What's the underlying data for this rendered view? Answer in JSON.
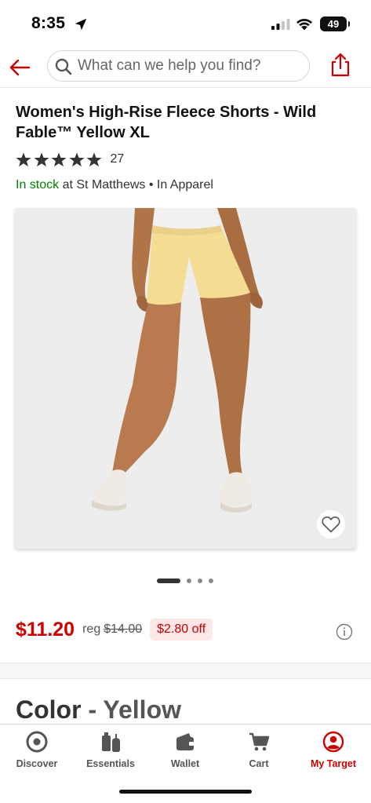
{
  "status_bar": {
    "time": "8:35",
    "battery": "49"
  },
  "search": {
    "placeholder": "What can we help you find?"
  },
  "product": {
    "title": "Women's High-Rise Fleece Shorts - Wild Fable™ Yellow XL",
    "rating": 5,
    "review_count": "27",
    "stock_status": "In stock",
    "stock_location": " at St Matthews • In Apparel",
    "price": "$11.20",
    "reg_label": "reg",
    "reg_price": "$14.00",
    "discount": "$2.80 off",
    "color_label": "Color",
    "color_separator": " - ",
    "color_value": "Yellow",
    "image_count": 4,
    "active_image": 1
  },
  "tabs": [
    {
      "label": "Discover",
      "icon": "target-logo-icon",
      "active": false
    },
    {
      "label": "Essentials",
      "icon": "essentials-icon",
      "active": false
    },
    {
      "label": "Wallet",
      "icon": "wallet-icon",
      "active": false
    },
    {
      "label": "Cart",
      "icon": "cart-icon",
      "active": false
    },
    {
      "label": "My Target",
      "icon": "account-icon",
      "active": true
    }
  ],
  "colors": {
    "brand_red": "#cc0000",
    "in_stock_green": "#008300",
    "shorts_yellow": "#f4dc93",
    "image_bg": "#ededed"
  }
}
